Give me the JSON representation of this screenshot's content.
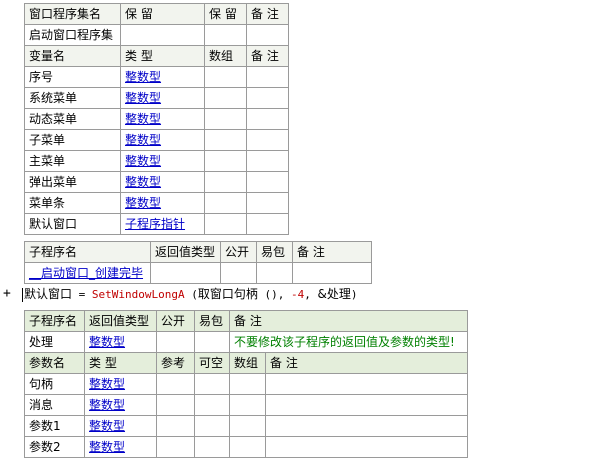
{
  "table1": {
    "header": [
      "窗口程序集名",
      "保 留",
      "保 留",
      "备 注"
    ],
    "row": [
      "启动窗口程序集",
      "",
      "",
      ""
    ],
    "var_header": [
      "变量名",
      "类 型",
      "数组",
      "备 注"
    ],
    "vars": [
      {
        "name": "序号",
        "type": "整数型"
      },
      {
        "name": "系统菜单",
        "type": "整数型"
      },
      {
        "name": "动态菜单",
        "type": "整数型"
      },
      {
        "name": "子菜单",
        "type": "整数型"
      },
      {
        "name": "主菜单",
        "type": "整数型"
      },
      {
        "name": "弹出菜单",
        "type": "整数型"
      },
      {
        "name": "菜单条",
        "type": "整数型"
      },
      {
        "name": "默认窗口",
        "type": "子程序指针"
      }
    ]
  },
  "table2": {
    "header": [
      "子程序名",
      "返回值类型",
      "公开",
      "易包",
      "备 注"
    ],
    "row": [
      "__启动窗口_创建完毕",
      "",
      "",
      "",
      ""
    ]
  },
  "code_line": {
    "plus": "+",
    "var": "默认窗口",
    "eq": " = ",
    "func": "SetWindowLongA",
    "open": " (",
    "arg1": "取窗口句柄",
    "arg1_paren": " (), ",
    "arg2": "-4",
    "sep": ", ",
    "arg3": "&处理",
    "close": ")"
  },
  "table3": {
    "header": [
      "子程序名",
      "返回值类型",
      "公开",
      "易包",
      "备 注"
    ],
    "row": [
      "处理",
      "整数型",
      "",
      "",
      "不要修改该子程序的返回值及参数的类型!"
    ],
    "param_header": [
      "参数名",
      "类 型",
      "参考",
      "可空",
      "数组",
      "备 注"
    ],
    "params": [
      {
        "name": "句柄",
        "type": "整数型"
      },
      {
        "name": "消息",
        "type": "整数型"
      },
      {
        "name": "参数1",
        "type": "整数型"
      },
      {
        "name": "参数2",
        "type": "整数型"
      }
    ]
  }
}
